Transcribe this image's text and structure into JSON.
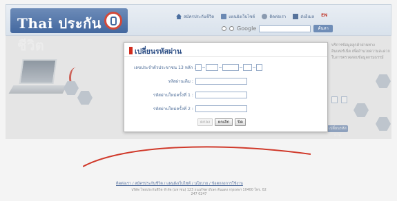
{
  "header": {
    "logo_text": "Thai ประกันชีวิต",
    "top_links": [
      "สมัครประกันชีวิต",
      "แผนผังเว็บไซต์",
      "ติดต่อเรา",
      "ส่งอีเมล"
    ],
    "lang_label": "EN",
    "search_engine_label": "Google",
    "search_button_label": "ค้นหา"
  },
  "background": {
    "side_text": "บริการข้อมูลลูกค้าผ่านทางอินเทอร์เน็ต เพื่ออำนวยความสะดวกในการตรวจสอบข้อมูลกรมธรรม์",
    "side_button_label": "เปลี่ยนรหัสผ่าน",
    "footer_links": "ติดต่อเรา / สมัครประกันชีวิต / แผนผังเว็บไซต์ / นโยบาย / ข้อตกลงการใช้งาน",
    "footer_address": "บริษัท ไทยประกันชีวิต จำกัด (มหาชน) 123 ถนนรัชดาภิเษก ดินแดง กรุงเทพฯ 10400 โทร. 02 247 0247"
  },
  "modal": {
    "title": "เปลี่ยนรหัสผ่าน",
    "id_label": "เลขประจำตัวประชาชน 13 หลัก :",
    "current_password_label": "รหัสผ่านเดิม :",
    "new_password_label": "รหัสผ่านใหม่ครั้งที่ 1 :",
    "confirm_password_label": "รหัสผ่านใหม่ครั้งที่ 2 :",
    "buttons": {
      "disabled_label": "ตกลง",
      "cancel_label": "ยกเลิก",
      "close_label": "ปิด"
    }
  }
}
